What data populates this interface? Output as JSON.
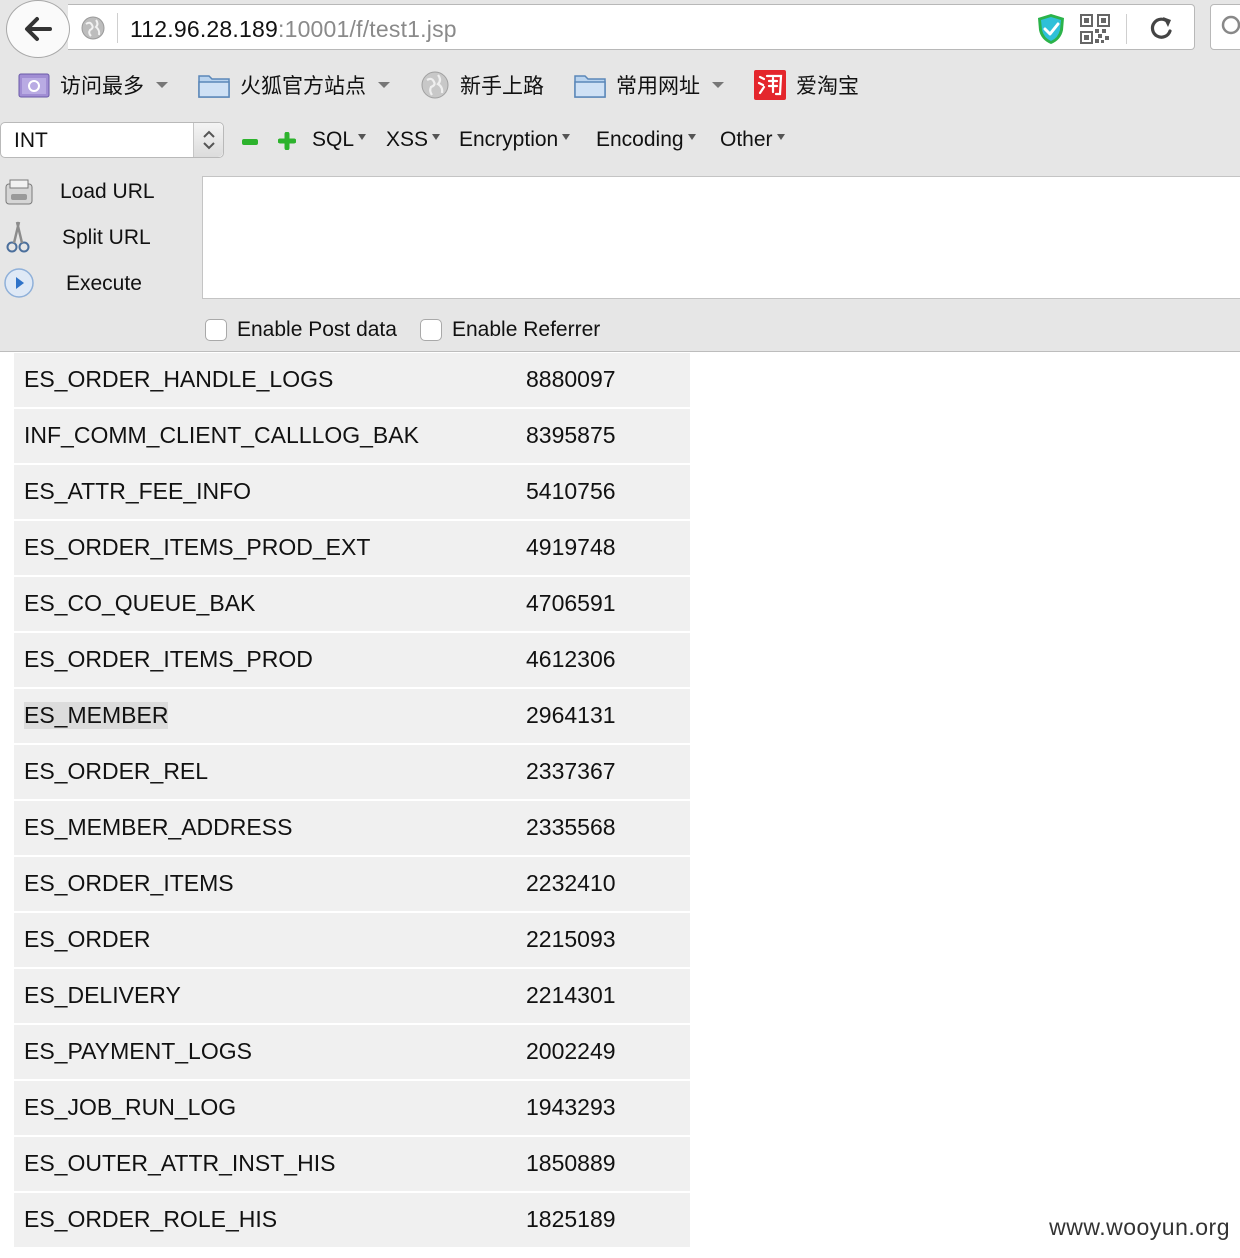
{
  "urlbar": {
    "url_host": "112.96.28.189",
    "url_rest": ":10001/f/test1.jsp",
    "icons": [
      "back-arrow-icon",
      "globe-icon",
      "shield-check-icon",
      "qr-code-icon",
      "reload-icon",
      "search-icon"
    ]
  },
  "bookmarks": [
    {
      "label": "访问最多",
      "icon": "most-visited-icon",
      "has_dropdown": true
    },
    {
      "label": "火狐官方站点",
      "icon": "folder-icon",
      "has_dropdown": true
    },
    {
      "label": "新手上路",
      "icon": "globe-icon",
      "has_dropdown": false
    },
    {
      "label": "常用网址",
      "icon": "folder-icon",
      "has_dropdown": true
    },
    {
      "label": "爱淘宝",
      "icon": "taobao-icon",
      "has_dropdown": false
    }
  ],
  "hackbar": {
    "select_value": "INT",
    "menus": [
      "SQL",
      "XSS",
      "Encryption",
      "Encoding",
      "Other"
    ],
    "actions": [
      "Load URL",
      "Split URL",
      "Execute"
    ],
    "url_input_value": "",
    "checkboxes": [
      {
        "label": "Enable Post data",
        "checked": false
      },
      {
        "label": "Enable Referrer",
        "checked": false
      }
    ]
  },
  "results": [
    {
      "name": "ES_ORDER_HANDLE_LOGS",
      "count": "8880097"
    },
    {
      "name": "INF_COMM_CLIENT_CALLLOG_BAK",
      "count": "8395875"
    },
    {
      "name": "ES_ATTR_FEE_INFO",
      "count": "5410756"
    },
    {
      "name": "ES_ORDER_ITEMS_PROD_EXT",
      "count": "4919748"
    },
    {
      "name": "ES_CO_QUEUE_BAK",
      "count": "4706591"
    },
    {
      "name": "ES_ORDER_ITEMS_PROD",
      "count": "4612306"
    },
    {
      "name": "ES_MEMBER",
      "count": "2964131",
      "highlighted": true
    },
    {
      "name": "ES_ORDER_REL",
      "count": "2337367"
    },
    {
      "name": "ES_MEMBER_ADDRESS",
      "count": "2335568"
    },
    {
      "name": "ES_ORDER_ITEMS",
      "count": "2232410"
    },
    {
      "name": "ES_ORDER",
      "count": "2215093"
    },
    {
      "name": "ES_DELIVERY",
      "count": "2214301"
    },
    {
      "name": "ES_PAYMENT_LOGS",
      "count": "2002249"
    },
    {
      "name": "ES_JOB_RUN_LOG",
      "count": "1943293"
    },
    {
      "name": "ES_OUTER_ATTR_INST_HIS",
      "count": "1850889"
    },
    {
      "name": "ES_ORDER_ROLE_HIS",
      "count": "1825189"
    }
  ],
  "watermark": "www.wooyun.org",
  "colors": {
    "toolbar_bg": "#e6e6e6",
    "row_bg": "#f0f0f0",
    "accent_green": "#2db32d",
    "shield_green": "#2bb34a",
    "taobao_red": "#e4262c"
  }
}
